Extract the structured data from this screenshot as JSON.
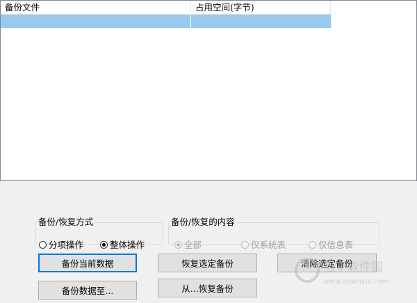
{
  "list": {
    "columns": [
      "备份文件",
      "占用空间(字节)"
    ],
    "rows": [
      [
        "",
        ""
      ]
    ],
    "selected_row_color": "#99c9ef"
  },
  "group_method": {
    "title": "备份/恢复方式",
    "options": [
      {
        "label": "分项操作",
        "checked": false,
        "enabled": true
      },
      {
        "label": "整体操作",
        "checked": true,
        "enabled": true
      }
    ]
  },
  "group_content": {
    "title": "备份/恢复的内容",
    "options": [
      {
        "label": "全部",
        "checked": true,
        "enabled": false
      },
      {
        "label": "仅系统表",
        "checked": false,
        "enabled": false
      },
      {
        "label": "仅信息表",
        "checked": false,
        "enabled": false
      }
    ]
  },
  "buttons": {
    "backup_current": "备份当前数据",
    "restore_selected": "恢复选定备份",
    "clear_selected": "清除选定备份",
    "backup_to": "备份数据至...",
    "restore_from": "从...恢复备份"
  },
  "watermark": {
    "text": "当下软件园",
    "url": "www.downxia.com"
  },
  "colors": {
    "default_button_border": "#0078d7",
    "window_background": "#f0f0f0"
  }
}
